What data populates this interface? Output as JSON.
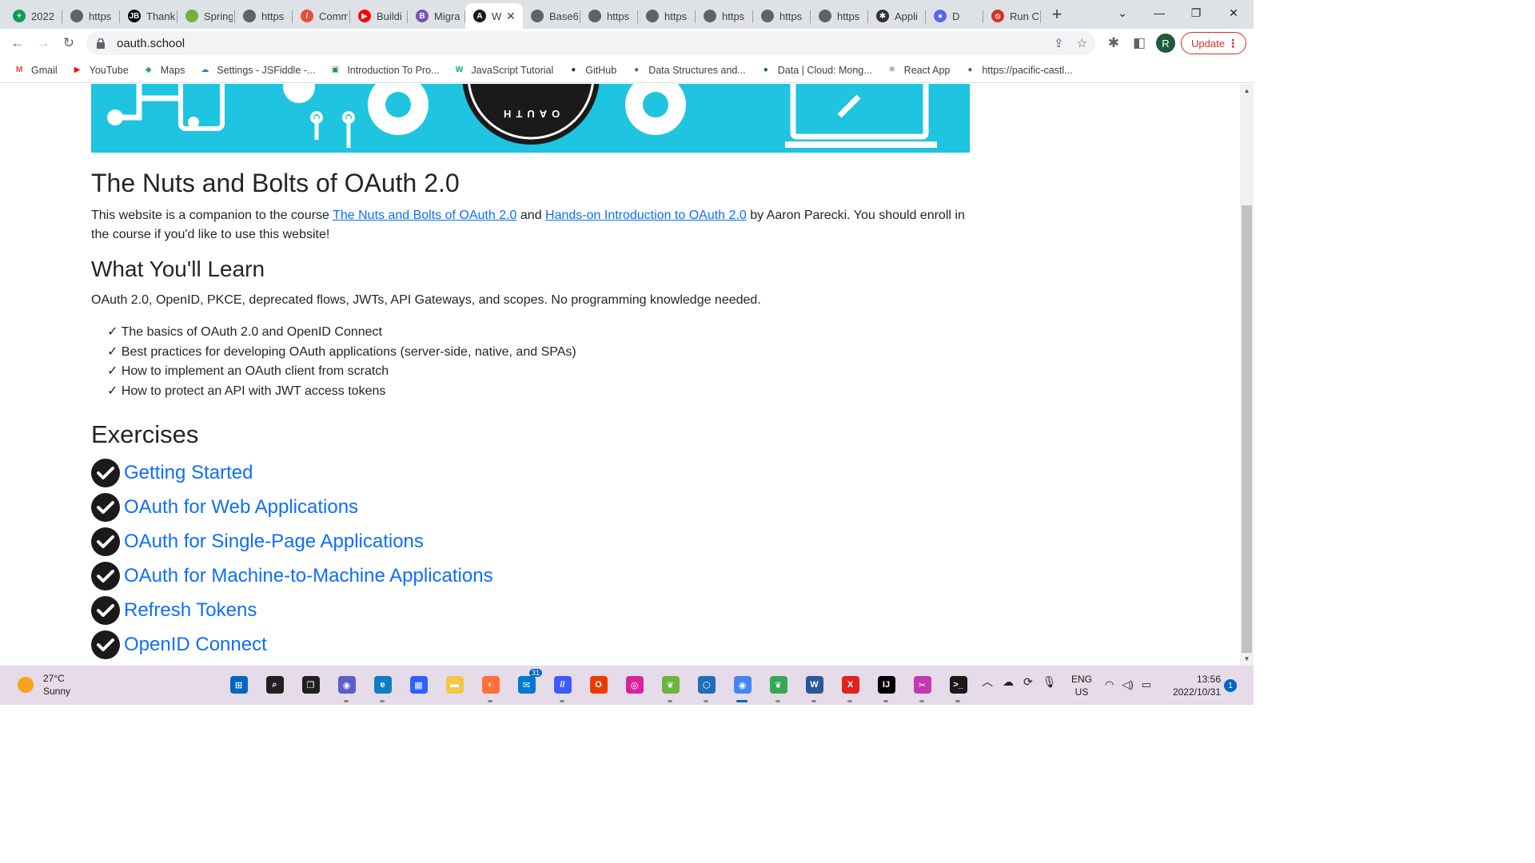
{
  "browser": {
    "tabs": [
      {
        "label": "2022",
        "icon": "sheets-icon",
        "color": "#0f9d58",
        "glyph": "+"
      },
      {
        "label": "https",
        "icon": "globe-icon",
        "color": "#5f6368",
        "glyph": ""
      },
      {
        "label": "Thank",
        "icon": "jetbrains-icon",
        "color": "#000000",
        "glyph": "JB"
      },
      {
        "label": "Spring",
        "icon": "spring-icon",
        "color": "#6db33f",
        "glyph": ""
      },
      {
        "label": "https",
        "icon": "globe-icon",
        "color": "#5f6368",
        "glyph": ""
      },
      {
        "label": "Comm",
        "icon": "pen-icon",
        "color": "#e74c3c",
        "glyph": "/"
      },
      {
        "label": "Buildi",
        "icon": "youtube-icon",
        "color": "#ff0000",
        "glyph": "▶"
      },
      {
        "label": "Migra",
        "icon": "bootstrap-icon",
        "color": "#7952b3",
        "glyph": "B"
      },
      {
        "label": "W",
        "icon": "oauth-icon",
        "color": "#1a1a1a",
        "glyph": "A",
        "active": true
      },
      {
        "label": "Base6",
        "icon": "globe-icon",
        "color": "#5f6368",
        "glyph": ""
      },
      {
        "label": "https",
        "icon": "globe-icon",
        "color": "#5f6368",
        "glyph": ""
      },
      {
        "label": "https",
        "icon": "globe-icon",
        "color": "#5f6368",
        "glyph": ""
      },
      {
        "label": "https",
        "icon": "globe-icon",
        "color": "#5f6368",
        "glyph": ""
      },
      {
        "label": "https",
        "icon": "globe-icon",
        "color": "#5f6368",
        "glyph": ""
      },
      {
        "label": "https",
        "icon": "globe-icon",
        "color": "#5f6368",
        "glyph": ""
      },
      {
        "label": "Appli",
        "icon": "applitools-icon",
        "color": "#333333",
        "glyph": "✱"
      },
      {
        "label": "D",
        "icon": "discord-icon",
        "color": "#5865f2",
        "glyph": "●"
      },
      {
        "label": "Run C",
        "icon": "runc-icon",
        "color": "#d93025",
        "glyph": "⦸"
      }
    ],
    "url": "oauth.school",
    "profile_initial": "R",
    "update_label": "Update",
    "accent": "#0d6efd"
  },
  "bookmarks": [
    {
      "label": "Gmail",
      "icon": "gmail-icon",
      "color": "#ea4335",
      "glyph": "M"
    },
    {
      "label": "YouTube",
      "icon": "youtube-icon",
      "color": "#ff0000",
      "glyph": "▶"
    },
    {
      "label": "Maps",
      "icon": "maps-icon",
      "color": "#34a853",
      "glyph": "◆"
    },
    {
      "label": "Settings - JSFiddle -...",
      "icon": "jsfiddle-icon",
      "color": "#4679bd",
      "glyph": "☁"
    },
    {
      "label": "Introduction To Pro...",
      "icon": "classroom-icon",
      "color": "#1e8e3e",
      "glyph": "▣"
    },
    {
      "label": "JavaScript Tutorial",
      "icon": "w3schools-icon",
      "color": "#04aa6d",
      "glyph": "W"
    },
    {
      "label": "GitHub",
      "icon": "github-icon",
      "color": "#24292f",
      "glyph": "●"
    },
    {
      "label": "Data Structures and...",
      "icon": "globe-icon",
      "color": "#5f6368",
      "glyph": "●"
    },
    {
      "label": "Data | Cloud: Mong...",
      "icon": "mongodb-icon",
      "color": "#00684a",
      "glyph": "●"
    },
    {
      "label": "React App",
      "icon": "react-icon",
      "color": "#20232a",
      "glyph": "⚛"
    },
    {
      "label": "https://pacific-castl...",
      "icon": "globe-icon",
      "color": "#5f6368",
      "glyph": "●"
    }
  ],
  "page": {
    "title": "The Nuts and Bolts of OAuth 2.0",
    "intro_prefix": "This website is a companion to the course ",
    "course_link_1": "The Nuts and Bolts of OAuth 2.0",
    "intro_and": " and ",
    "course_link_2": "Hands-on Introduction to OAuth 2.0",
    "intro_suffix": " by Aaron Parecki. You should enroll in the course if you'd like to use this website!",
    "learn_heading": "What You'll Learn",
    "learn_summary": "OAuth 2.0, OpenID, PKCE, deprecated flows, JWTs, API Gateways, and scopes. No programming knowledge needed.",
    "learn_items": [
      "✓ The basics of OAuth 2.0 and OpenID Connect",
      "✓ Best practices for developing OAuth applications (server-side, native, and SPAs)",
      "✓ How to implement an OAuth client from scratch",
      "✓ How to protect an API with JWT access tokens"
    ],
    "exercises_heading": "Exercises",
    "exercises": [
      "Getting Started",
      "OAuth for Web Applications",
      "OAuth for Single-Page Applications",
      "OAuth for Machine-to-Machine Applications",
      "Refresh Tokens",
      "OpenID Connect"
    ],
    "hero_logo_text": "OAUTH",
    "hero_color": "#1ec4e0"
  },
  "taskbar": {
    "weather_temp": "27°C",
    "weather_cond": "Sunny",
    "apps": [
      {
        "name": "start-icon",
        "color": "#0067c0",
        "glyph": "⊞"
      },
      {
        "name": "search-icon",
        "color": "#202020",
        "glyph": "⌕"
      },
      {
        "name": "taskview-icon",
        "color": "#202020",
        "glyph": "❐"
      },
      {
        "name": "teams-chat-icon",
        "color": "#5b5fc7",
        "glyph": "◉"
      },
      {
        "name": "edge-icon",
        "color": "#0c7fc2",
        "glyph": "e"
      },
      {
        "name": "store-icon",
        "color": "#2962ff",
        "glyph": "▦"
      },
      {
        "name": "explorer-icon",
        "color": "#f2c744",
        "glyph": "▬"
      },
      {
        "name": "firefox-icon",
        "color": "#ff7139",
        "glyph": "◐"
      },
      {
        "name": "mail-icon",
        "color": "#0078d4",
        "glyph": "✉",
        "badge": "31"
      },
      {
        "name": "dev-icon",
        "color": "#3d5afe",
        "glyph": "//"
      },
      {
        "name": "office-icon",
        "color": "#eb3c00",
        "glyph": "O"
      },
      {
        "name": "instagram-icon",
        "color": "#d6249f",
        "glyph": "◎"
      },
      {
        "name": "spring-tool-icon",
        "color": "#6db33f",
        "glyph": "❦"
      },
      {
        "name": "virtualbox-icon",
        "color": "#1d6fb8",
        "glyph": "⬡"
      },
      {
        "name": "chrome-icon",
        "color": "#4285f4",
        "glyph": "◉",
        "active": true
      },
      {
        "name": "sts-icon",
        "color": "#34a853",
        "glyph": "❦"
      },
      {
        "name": "word-icon",
        "color": "#2b579a",
        "glyph": "W"
      },
      {
        "name": "pdf-icon",
        "color": "#e2231a",
        "glyph": "X"
      },
      {
        "name": "intellij-icon",
        "color": "#000000",
        "glyph": "IJ"
      },
      {
        "name": "snipping-icon",
        "color": "#c239b3",
        "glyph": "✂"
      },
      {
        "name": "terminal-icon",
        "color": "#1a1a1a",
        "glyph": ">_"
      }
    ],
    "lang_top": "ENG",
    "lang_bottom": "US",
    "time": "13:56",
    "date": "2022/10/31",
    "notification_count": "1"
  }
}
